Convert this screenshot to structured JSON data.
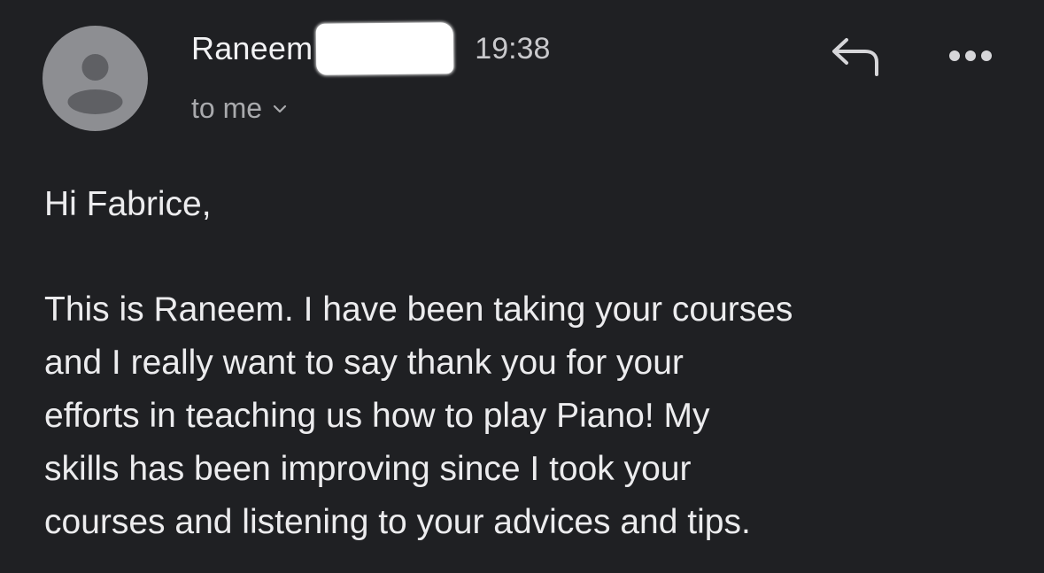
{
  "email": {
    "sender_name": "Raneem",
    "time": "19:38",
    "recipient_label": "to me"
  },
  "icons": {
    "avatar": "person-avatar-icon",
    "reply": "reply-arrow-icon",
    "more": "more-horizontal-icon",
    "chevron": "chevron-down-icon"
  },
  "body": {
    "greeting": "Hi Fabrice,",
    "lines": [
      "This is Raneem. I have been taking your courses",
      "and I really want to say thank you for your",
      "efforts in teaching us how to play Piano! My",
      "skills has been improving since I took your",
      "courses and listening to your advices and tips."
    ]
  },
  "colors": {
    "background": "#1f2023",
    "avatar": "#8d8e92",
    "text": "#ececee",
    "muted": "#a9aaad"
  }
}
